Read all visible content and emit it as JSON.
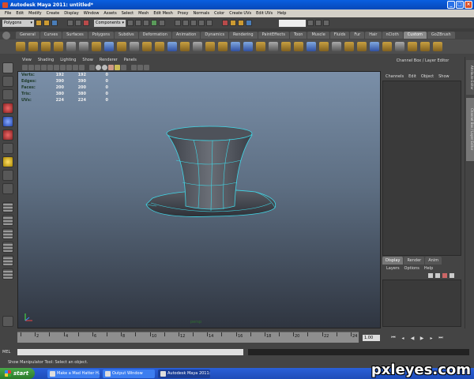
{
  "window": {
    "title": "Autodesk Maya 2011: untitled*"
  },
  "menu": [
    "File",
    "Edit",
    "Modify",
    "Create",
    "Display",
    "Window",
    "Assets",
    "Select",
    "Mesh",
    "Edit Mesh",
    "Proxy",
    "Normals",
    "Color",
    "Create UVs",
    "Edit UVs",
    "Help"
  ],
  "status_line": {
    "mode": "Polygons",
    "selection_field": "Components"
  },
  "shelf_tabs": [
    "General",
    "Curves",
    "Surfaces",
    "Polygons",
    "Subdivs",
    "Deformation",
    "Animation",
    "Dynamics",
    "Rendering",
    "PaintEffects",
    "Toon",
    "Muscle",
    "Fluids",
    "Fur",
    "Hair",
    "nCloth",
    "Custom",
    "GoZBrush"
  ],
  "shelf_active": "Custom",
  "panel_menu": [
    "View",
    "Shading",
    "Lighting",
    "Show",
    "Renderer",
    "Panels"
  ],
  "hud": [
    {
      "label": "Verts:",
      "v1": "192",
      "v2": "192",
      "v3": "0"
    },
    {
      "label": "Edges:",
      "v1": "390",
      "v2": "390",
      "v3": "0"
    },
    {
      "label": "Faces:",
      "v1": "200",
      "v2": "200",
      "v3": "0"
    },
    {
      "label": "Tris:",
      "v1": "380",
      "v2": "380",
      "v3": "0"
    },
    {
      "label": "UVs:",
      "v1": "224",
      "v2": "224",
      "v3": "0"
    }
  ],
  "viewport_label": "persp",
  "channel_box": {
    "title": "Channel Box / Layer Editor",
    "menu": [
      "Channels",
      "Edit",
      "Object",
      "Show"
    ]
  },
  "layer_editor": {
    "tabs": [
      "Display",
      "Render",
      "Anim"
    ],
    "menu": [
      "Layers",
      "Options",
      "Help"
    ]
  },
  "side_tabs": [
    "Attribute Editor",
    "Channel Box / Layer Editor"
  ],
  "timeline": {
    "ticks": [
      "2",
      "4",
      "6",
      "8",
      "10",
      "12",
      "14",
      "16",
      "18",
      "20",
      "22",
      "24"
    ],
    "current_frame": "1.00"
  },
  "mel": {
    "label": "MEL"
  },
  "help_line": "Show Manipulator Tool: Select an object.",
  "taskbar": {
    "start": "start",
    "tasks": [
      "Make a Mad Hatter H...",
      "Output Window",
      "Autodesk Maya 2011:..."
    ]
  },
  "watermark": "pxleyes.com",
  "colors": {
    "viewport_top": "#7a8fa8",
    "viewport_bottom": "#2f3540",
    "wire": "#40d8e8",
    "hat": "#5a5e66"
  }
}
